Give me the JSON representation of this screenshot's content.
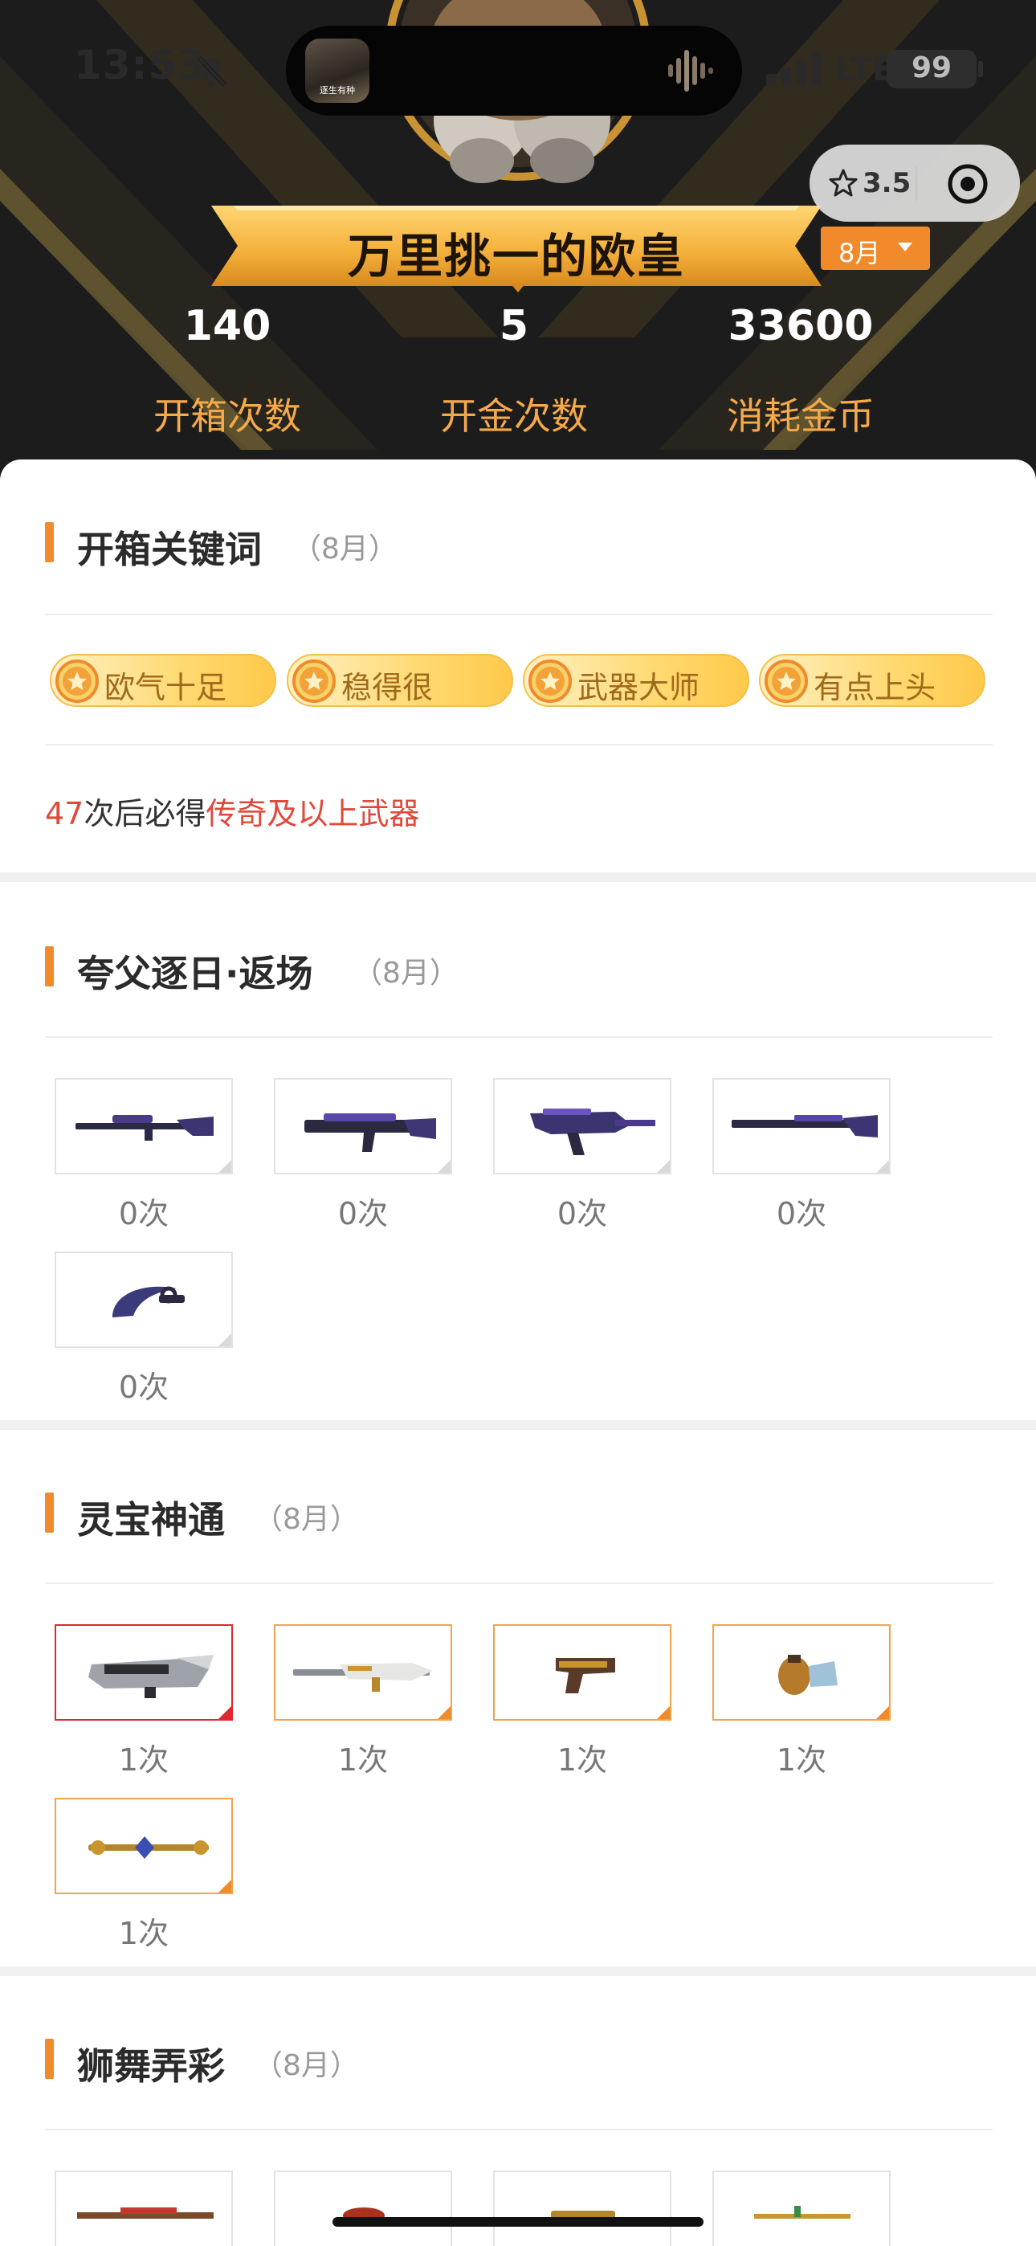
{
  "status_bar": {
    "time": "13:53",
    "network": "LTE",
    "battery": "99",
    "app_icon_label": "逐生有种"
  },
  "capsule": {
    "rating": "3.5"
  },
  "hero": {
    "title": "万里挑一的欧皇",
    "month_selector": "8月",
    "stats": [
      {
        "value": "140",
        "label": "开箱次数"
      },
      {
        "value": "5",
        "label": "开金次数"
      },
      {
        "value": "33600",
        "label": "消耗金币"
      }
    ]
  },
  "keywords": {
    "title": "开箱关键词",
    "subtitle": "（8月）",
    "tags": [
      "欧气十足",
      "稳得很",
      "武器大师",
      "有点上头"
    ],
    "guarantee": {
      "count": "47",
      "middle": "次后必得",
      "highlight": "传奇及以上武器"
    }
  },
  "sections": [
    {
      "title": "夸父逐日·返场",
      "subtitle": "（8月）",
      "items": [
        {
          "count": "0次",
          "icon": "sniper-rifle-purple-icon"
        },
        {
          "count": "0次",
          "icon": "assault-rifle-purple-icon"
        },
        {
          "count": "0次",
          "icon": "smg-purple-icon"
        },
        {
          "count": "0次",
          "icon": "long-rifle-purple-icon"
        },
        {
          "count": "0次",
          "icon": "karambit-purple-icon"
        }
      ]
    },
    {
      "title": "灵宝神通",
      "subtitle": "（8月）",
      "items": [
        {
          "count": "1次",
          "icon": "heavy-gun-silver-icon"
        },
        {
          "count": "1次",
          "icon": "rifle-white-gold-icon"
        },
        {
          "count": "1次",
          "icon": "pistol-gold-icon"
        },
        {
          "count": "1次",
          "icon": "grenade-gold-icon"
        },
        {
          "count": "1次",
          "icon": "melee-staff-gold-icon"
        }
      ]
    },
    {
      "title": "狮舞弄彩",
      "subtitle": "（8月）",
      "items": [
        {
          "icon": "rifle-lion-icon"
        },
        {
          "icon": "weapon-red-icon"
        },
        {
          "icon": "weapon-gold-icon"
        },
        {
          "icon": "weapon-green-icon"
        }
      ]
    }
  ],
  "colors": {
    "accent": "#f08a2a",
    "stat_label": "#f5a94a",
    "highlight_red": "#e0483a",
    "item_border_orange": "#f3a24d",
    "item_border_red": "#e0262e"
  }
}
